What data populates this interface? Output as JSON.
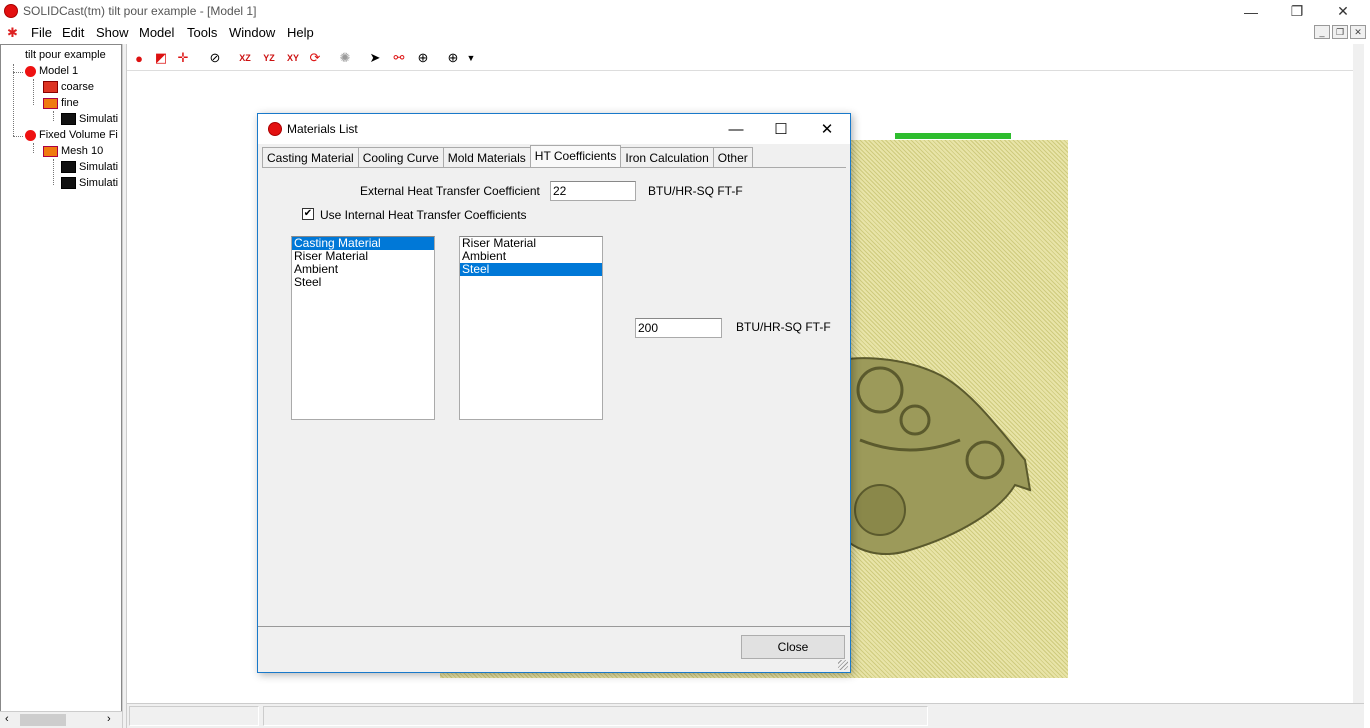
{
  "window": {
    "title": "SOLIDCast(tm) tilt pour example - [Model 1]",
    "minimize": "—",
    "restore": "❐",
    "close": "✕"
  },
  "menu": [
    "File",
    "Edit",
    "Show",
    "Model",
    "Tools",
    "Window",
    "Help"
  ],
  "mdi": {
    "minimize": "_",
    "restore": "❐",
    "close": "✕"
  },
  "tree": {
    "root": "tilt pour example",
    "model1": "Model 1",
    "coarse": "coarse",
    "fine": "fine",
    "sim1": "Simulati",
    "fixed": "Fixed Volume Fi",
    "mesh10": "Mesh 10",
    "sim2": "Simulati",
    "sim3": "Simulati"
  },
  "dialog": {
    "title": "Materials List",
    "tabs": [
      "Casting Material",
      "Cooling Curve",
      "Mold Materials",
      "HT Coefficients",
      "Iron Calculation",
      "Other"
    ],
    "active_tab": "HT Coefficients",
    "ext_label": "External Heat Transfer Coefficient",
    "ext_value": "22",
    "ext_unit": "BTU/HR-SQ FT-F",
    "use_internal_label": "Use Internal Heat Transfer Coefficients",
    "use_internal_checked": true,
    "list_left": [
      "Casting Material",
      "Riser Material",
      "Ambient",
      "Steel"
    ],
    "list_left_selected": "Casting Material",
    "list_right": [
      "Riser Material",
      "Ambient",
      "Steel"
    ],
    "list_right_selected": "Steel",
    "pair_value": "200",
    "pair_unit": "BTU/HR-SQ FT-F",
    "close_label": "Close"
  },
  "colors": {
    "accent": "#0078d7",
    "mesh": "#d6d38c",
    "riser": "#2ebd2e"
  }
}
